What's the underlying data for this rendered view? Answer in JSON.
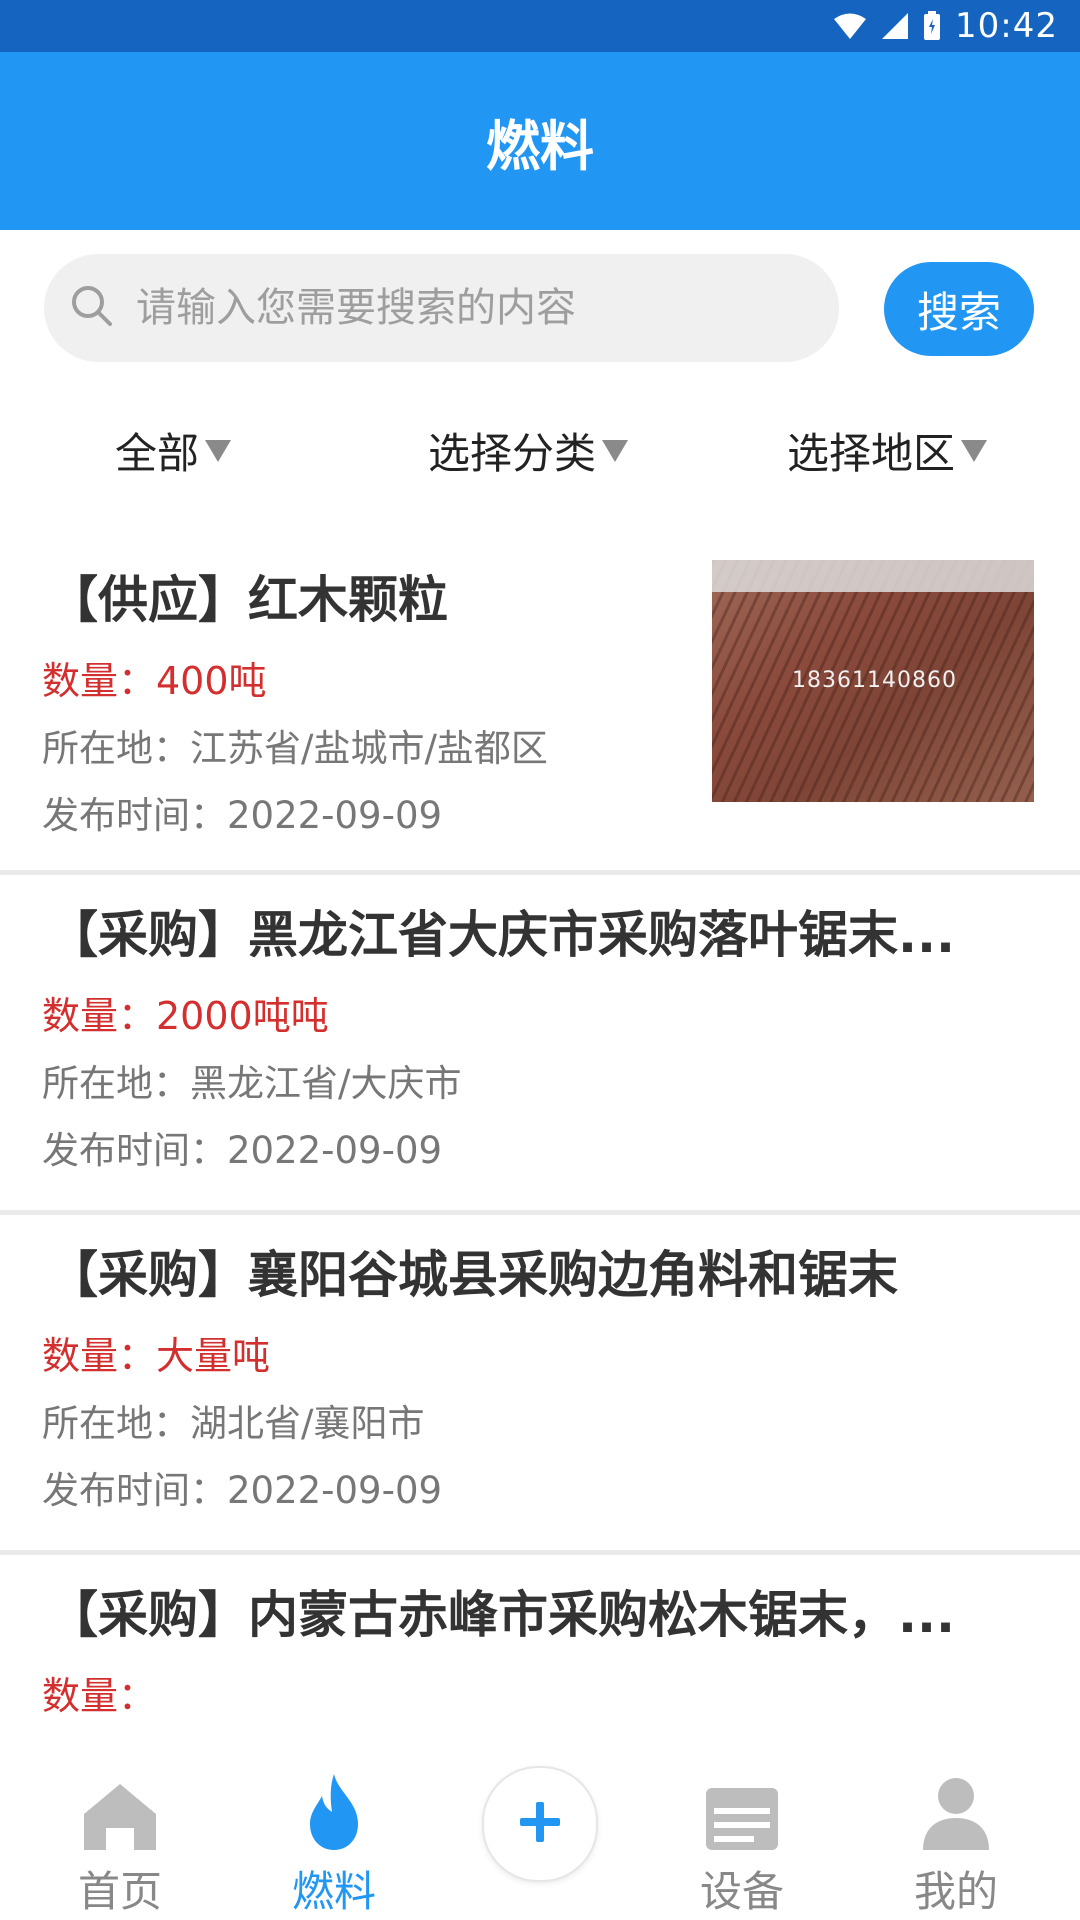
{
  "status_bar": {
    "time": "10:42"
  },
  "header": {
    "title": "燃料"
  },
  "search": {
    "placeholder": "请输入您需要搜索的内容",
    "button_label": "搜索"
  },
  "filters": [
    {
      "label": "全部"
    },
    {
      "label": "选择分类"
    },
    {
      "label": "选择地区"
    }
  ],
  "listings": [
    {
      "title": "【供应】红木颗粒",
      "quantity": "数量：400吨",
      "location": "所在地：江苏省/盐城市/盐都区",
      "date": "发布时间：2022-09-09",
      "image_watermark": "18361140860"
    },
    {
      "title": "【采购】黑龙江省大庆市采购落叶锯末...",
      "quantity": "数量：2000吨吨",
      "location": "所在地：黑龙江省/大庆市",
      "date": "发布时间：2022-09-09"
    },
    {
      "title": "【采购】襄阳谷城县采购边角料和锯末",
      "quantity": "数量：大量吨",
      "location": "所在地：湖北省/襄阳市",
      "date": "发布时间：2022-09-09"
    },
    {
      "title": "【采购】内蒙古赤峰市采购松木锯末，...",
      "quantity": "数量："
    }
  ],
  "tabbar": {
    "home": "首页",
    "fuel": "燃料",
    "equipment": "设备",
    "mine": "我的"
  },
  "colors": {
    "primary": "#2196f3",
    "status_bar": "#1565c0",
    "quantity_red": "#d32f2f"
  }
}
